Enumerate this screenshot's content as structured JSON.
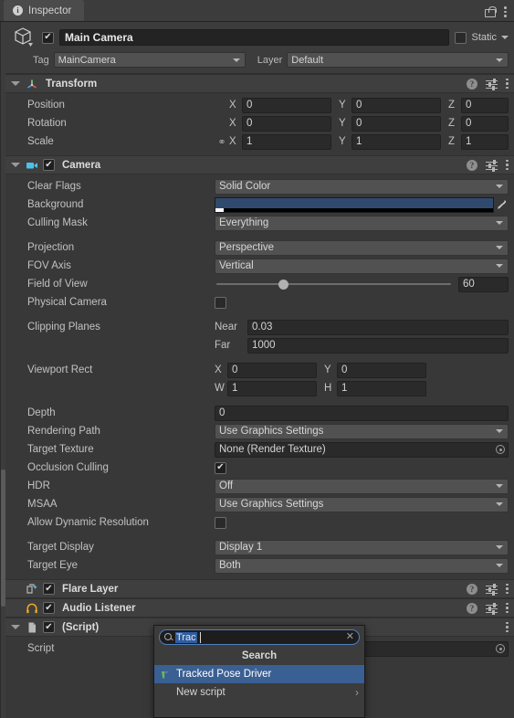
{
  "tab": {
    "title": "Inspector",
    "info_icon": "info-icon",
    "lock_icon": "lock-icon",
    "menu_icon": "kebab-menu-icon"
  },
  "gameobject": {
    "icon": "cube-icon",
    "enabled": true,
    "name": "Main Camera",
    "static_label": "Static",
    "static_checked": false,
    "tag_label": "Tag",
    "tag_value": "MainCamera",
    "layer_label": "Layer",
    "layer_value": "Default"
  },
  "components": [
    {
      "name": "Transform",
      "icon": "transform-axis-icon",
      "has_checkbox": false,
      "expanded": true,
      "rows": [
        {
          "label": "Position",
          "type": "vector3",
          "x": "0",
          "y": "0",
          "z": "0"
        },
        {
          "label": "Rotation",
          "type": "vector3",
          "x": "0",
          "y": "0",
          "z": "0"
        },
        {
          "label": "Scale",
          "type": "vector3-locked",
          "x": "1",
          "y": "1",
          "z": "1"
        }
      ]
    },
    {
      "name": "Camera",
      "icon": "camera-icon",
      "has_checkbox": true,
      "checked": true,
      "expanded": true,
      "rows": [
        {
          "label": "Clear Flags",
          "type": "dropdown",
          "value": "Solid Color"
        },
        {
          "label": "Background",
          "type": "color",
          "color": "#2f4a6e",
          "alpha_color": "#000000"
        },
        {
          "label": "Culling Mask",
          "type": "dropdown",
          "value": "Everything"
        },
        {
          "type": "spacer"
        },
        {
          "label": "Projection",
          "type": "dropdown",
          "value": "Perspective"
        },
        {
          "label": "FOV Axis",
          "type": "dropdown",
          "value": "Vertical"
        },
        {
          "label": "Field of View",
          "type": "slider",
          "value": "60",
          "percent": 27
        },
        {
          "label": "Physical Camera",
          "type": "checkbox",
          "checked": false
        },
        {
          "type": "spacer"
        },
        {
          "label": "Clipping Planes",
          "type": "pair",
          "k1": "Near",
          "v1": "0.03"
        },
        {
          "label": "",
          "type": "pair",
          "k1": "Far",
          "v1": "1000"
        },
        {
          "type": "spacer"
        },
        {
          "label": "Viewport Rect",
          "type": "xy",
          "k1": "X",
          "v1": "0",
          "k2": "Y",
          "v2": "0"
        },
        {
          "label": "",
          "type": "xy",
          "k1": "W",
          "v1": "1",
          "k2": "H",
          "v2": "1"
        },
        {
          "type": "spacer"
        },
        {
          "label": "Depth",
          "type": "text",
          "value": "0"
        },
        {
          "label": "Rendering Path",
          "type": "dropdown",
          "value": "Use Graphics Settings"
        },
        {
          "label": "Target Texture",
          "type": "object",
          "value": "None (Render Texture)"
        },
        {
          "label": "Occlusion Culling",
          "type": "checkbox",
          "checked": true
        },
        {
          "label": "HDR",
          "type": "dropdown",
          "value": "Off"
        },
        {
          "label": "MSAA",
          "type": "dropdown",
          "value": "Use Graphics Settings"
        },
        {
          "label": "Allow Dynamic Resolution",
          "type": "checkbox",
          "checked": false
        },
        {
          "type": "spacer"
        },
        {
          "label": "Target Display",
          "type": "dropdown",
          "value": "Display 1"
        },
        {
          "label": "Target Eye",
          "type": "dropdown",
          "value": "Both"
        }
      ]
    },
    {
      "name": "Flare Layer",
      "icon": "flare-layer-icon",
      "has_checkbox": true,
      "checked": true,
      "expanded": false,
      "rows": []
    },
    {
      "name": "Audio Listener",
      "icon": "audio-listener-icon",
      "has_checkbox": true,
      "checked": true,
      "expanded": false,
      "rows": []
    },
    {
      "name": "(Script)",
      "icon": "script-file-icon",
      "has_checkbox": true,
      "checked": true,
      "expanded": true,
      "rows": [
        {
          "label": "Script",
          "type": "object",
          "value": ""
        }
      ]
    }
  ],
  "popup": {
    "search_value": "Trac",
    "search_icon": "search-icon",
    "clear_icon": "clear-icon",
    "title": "Search",
    "items": [
      {
        "label": "Tracked Pose Driver",
        "selected": true,
        "icon": "script-asset-icon",
        "has_submenu": false
      },
      {
        "label": "New script",
        "selected": false,
        "icon": "",
        "has_submenu": true
      }
    ]
  },
  "colors": {
    "panel_bg": "#383838",
    "header_bg": "#3c3c3c",
    "component_header": "#3f3f3f",
    "field_bg": "#2a2a2a",
    "dropdown_bg": "#515151",
    "selection_blue": "#3a5f92",
    "text_selection": "#2f5d9e",
    "background_color_value": "#2f4a6e"
  }
}
